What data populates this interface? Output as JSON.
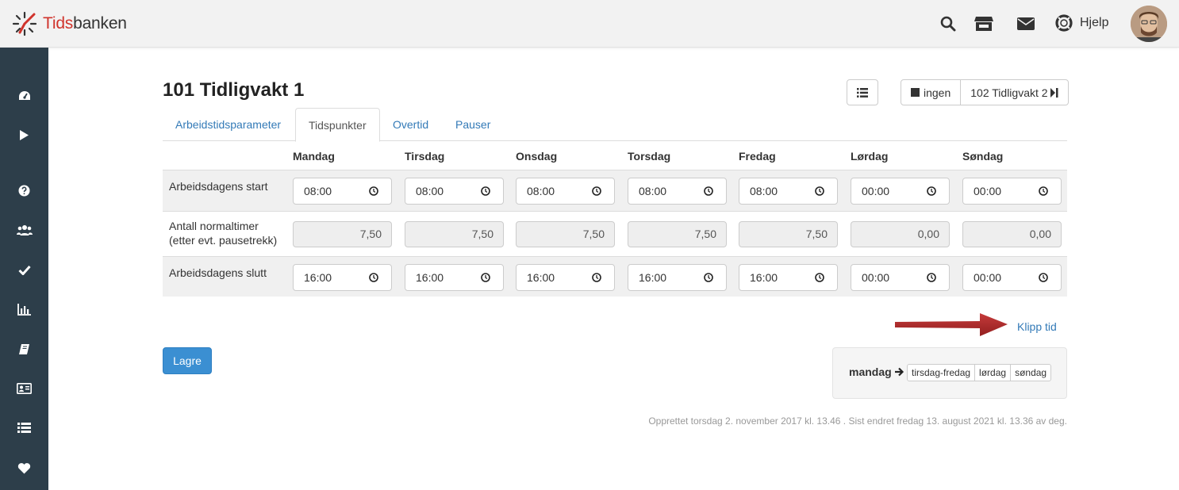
{
  "app": {
    "logo_text_red": "Tids",
    "logo_text_dark": "banken"
  },
  "topbar": {
    "help_label": "Hjelp",
    "icons": [
      "search-icon",
      "store-icon",
      "mail-icon",
      "lifebuoy-icon"
    ]
  },
  "sidebar": {
    "items": [
      "dashboard-icon",
      "play-icon",
      "question-icon",
      "users-icon",
      "check-icon",
      "bar-chart-icon",
      "book-icon",
      "id-card-icon",
      "list-icon",
      "heart-icon"
    ]
  },
  "page": {
    "title": "101 Tidligvakt 1"
  },
  "nav": {
    "prev_label": "ingen",
    "next_label": "102 Tidligvakt 2"
  },
  "tabs": [
    {
      "label": "Arbeidstidsparameter",
      "active": false
    },
    {
      "label": "Tidspunkter",
      "active": true
    },
    {
      "label": "Overtid",
      "active": false
    },
    {
      "label": "Pauser",
      "active": false
    }
  ],
  "table": {
    "days": [
      "Mandag",
      "Tirsdag",
      "Onsdag",
      "Torsdag",
      "Fredag",
      "Lørdag",
      "Søndag"
    ],
    "rows": {
      "start": {
        "label": "Arbeidsdagens start",
        "values": [
          "08:00",
          "08:00",
          "08:00",
          "08:00",
          "08:00",
          "00:00",
          "00:00"
        ]
      },
      "hours": {
        "label_line1": "Antall normaltimer",
        "label_line2": "(etter evt. pausetrekk)",
        "values": [
          "7,50",
          "7,50",
          "7,50",
          "7,50",
          "7,50",
          "0,00",
          "0,00"
        ]
      },
      "end": {
        "label": "Arbeidsdagens slutt",
        "values": [
          "16:00",
          "16:00",
          "16:00",
          "16:00",
          "16:00",
          "00:00",
          "00:00"
        ]
      }
    }
  },
  "actions": {
    "klipp_label": "Klipp tid",
    "save_label": "Lagre"
  },
  "copy": {
    "source": "mandag",
    "targets": [
      "tirsdag-fredag",
      "lørdag",
      "søndag"
    ]
  },
  "footer": {
    "text": "Opprettet torsdag 2. november 2017 kl. 13.46 . Sist endret fredag 13. august 2021 kl. 13.36 av deg."
  },
  "colors": {
    "sidebar_bg": "#2d3e4a",
    "link": "#337ab7",
    "primary": "#3b8fd2",
    "logo_red": "#d0342c",
    "arrow_red": "#a81b1b"
  }
}
